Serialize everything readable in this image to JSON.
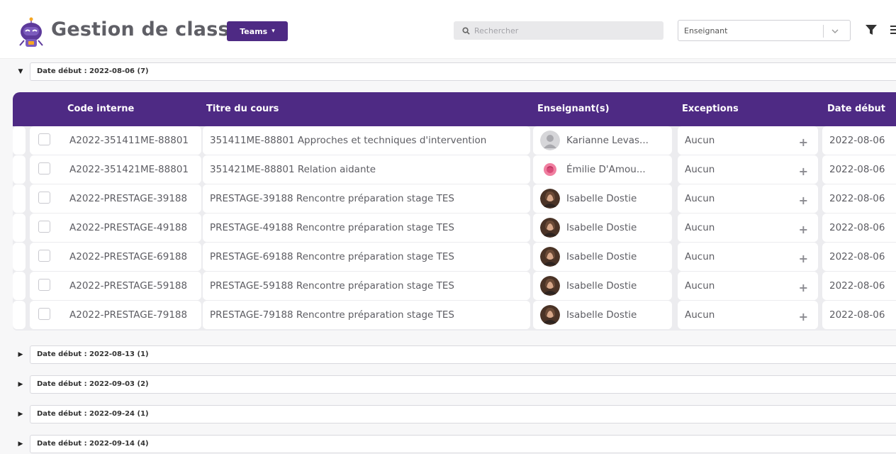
{
  "header": {
    "app_title": "Gestion de classes",
    "teams_label": "Teams",
    "search_placeholder": "Rechercher",
    "teacher_select_placeholder": "Enseignant"
  },
  "colors": {
    "brand": "#4e2a84",
    "row_bg": "#ffffff",
    "table_bg": "#ececef"
  },
  "open_group": {
    "label": "Date début : 2022-08-06 (7)"
  },
  "columns": {
    "code": "Code interne",
    "title": "Titre du cours",
    "teacher": "Enseignant(s)",
    "exceptions": "Exceptions",
    "start_date": "Date début"
  },
  "rows": [
    {
      "code": "A2022-351411ME-88801",
      "title": "351411ME-88801 Approches et techniques d'intervention",
      "teacher": "Karianne Levas...",
      "avatar": "default-avatar",
      "exceptions": "Aucun",
      "date": "2022-08-06"
    },
    {
      "code": "A2022-351421ME-88801",
      "title": "351421ME-88801 Relation aidante",
      "teacher": "Émilie D'Amou...",
      "avatar": "rose-avatar",
      "exceptions": "Aucun",
      "date": "2022-08-06"
    },
    {
      "code": "A2022-PRESTAGE-39188",
      "title": "PRESTAGE-39188 Rencontre préparation stage TES",
      "teacher": "Isabelle Dostie",
      "avatar": "photo-avatar",
      "exceptions": "Aucun",
      "date": "2022-08-06"
    },
    {
      "code": "A2022-PRESTAGE-49188",
      "title": "PRESTAGE-49188 Rencontre préparation stage TES",
      "teacher": "Isabelle Dostie",
      "avatar": "photo-avatar",
      "exceptions": "Aucun",
      "date": "2022-08-06"
    },
    {
      "code": "A2022-PRESTAGE-69188",
      "title": "PRESTAGE-69188 Rencontre préparation stage TES",
      "teacher": "Isabelle Dostie",
      "avatar": "photo-avatar",
      "exceptions": "Aucun",
      "date": "2022-08-06"
    },
    {
      "code": "A2022-PRESTAGE-59188",
      "title": "PRESTAGE-59188 Rencontre préparation stage TES",
      "teacher": "Isabelle Dostie",
      "avatar": "photo-avatar",
      "exceptions": "Aucun",
      "date": "2022-08-06"
    },
    {
      "code": "A2022-PRESTAGE-79188",
      "title": "PRESTAGE-79188 Rencontre préparation stage TES",
      "teacher": "Isabelle Dostie",
      "avatar": "photo-avatar",
      "exceptions": "Aucun",
      "date": "2022-08-06"
    }
  ],
  "collapsed_groups": [
    "Date début : 2022-08-13 (1)",
    "Date début : 2022-09-03 (2)",
    "Date début : 2022-09-24 (1)",
    "Date début : 2022-09-14 (4)"
  ]
}
